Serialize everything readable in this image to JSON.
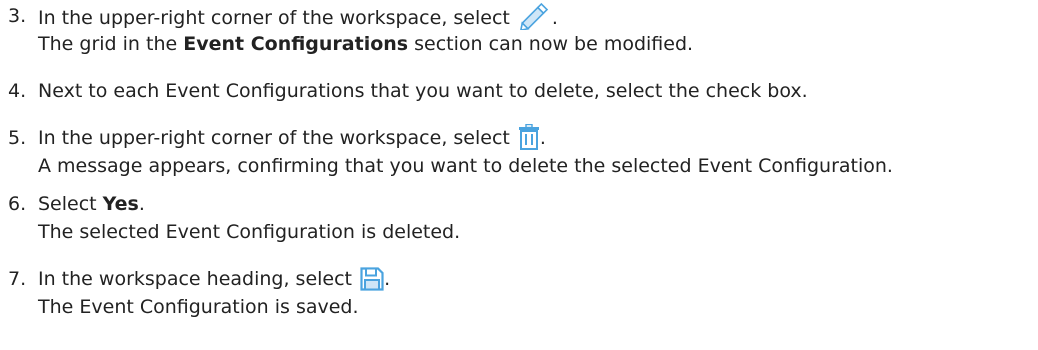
{
  "steps": [
    {
      "number": "3.",
      "text_before_icon": "In the upper-right corner of the workspace, select ",
      "text_after_icon": ".",
      "icon": "pencil-icon",
      "result_before": "The grid in the ",
      "result_bold": "Event Configurations",
      "result_after": " section can now be modified."
    },
    {
      "number": "4.",
      "text": "Next to each Event Configurations that you want to delete, select the check box."
    },
    {
      "number": "5.",
      "text_before_icon": "In the upper-right corner of the workspace, select ",
      "text_after_icon": ".",
      "icon": "trash-icon",
      "result": "A message appears, confirming that you want to delete the selected Event Configuration."
    },
    {
      "number": "6.",
      "text_before_bold": "Select ",
      "text_bold": "Yes",
      "text_after_bold": ".",
      "result": "The selected Event Configuration is deleted."
    },
    {
      "number": "7.",
      "text_before_icon": "In the workspace heading, select ",
      "text_after_icon": ".",
      "icon": "save-icon",
      "result": "The Event Configuration is saved."
    }
  ],
  "colors": {
    "text": "#222222",
    "icon_blue": "#4aa3df",
    "icon_blue_light": "#cfe6f7"
  }
}
